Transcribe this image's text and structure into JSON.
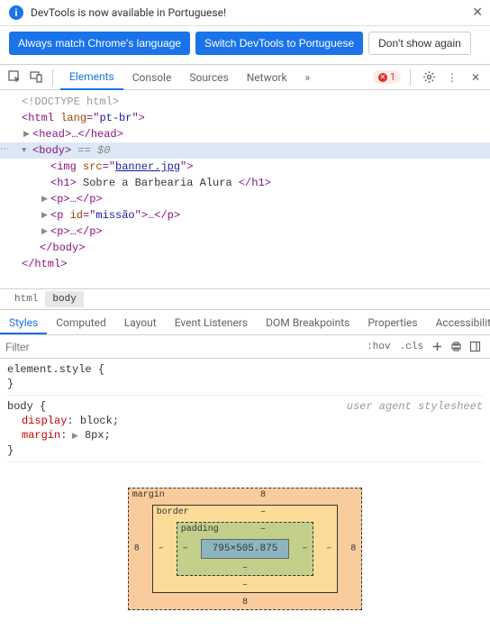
{
  "infobar": {
    "message": "DevTools is now available in Portuguese!",
    "buttons": {
      "match": "Always match Chrome's language",
      "switch": "Switch DevTools to Portuguese",
      "dismiss": "Don't show again"
    }
  },
  "toolbar": {
    "tabs": [
      "Elements",
      "Console",
      "Sources",
      "Network"
    ],
    "active_tab": "Elements",
    "errors": "1"
  },
  "dom": {
    "l0": "<!DOCTYPE html>",
    "l1_open": "<",
    "l1_tag": "html",
    "l1_attr": " lang",
    "l1_eq": "=\"",
    "l1_val": "pt-br",
    "l1_close": "\">",
    "l2_open": "<",
    "l2_tag": "head",
    "l2_close": ">",
    "l2_ell": "…",
    "l2_eopen": "</",
    "l2_eclose": ">",
    "l3_open": "<",
    "l3_tag": "body",
    "l3_close": ">",
    "l3_hint": " == $0",
    "l4_open": "<",
    "l4_tag": "img",
    "l4_attr": " src",
    "l4_eq": "=\"",
    "l4_val": "banner.jpg",
    "l4_close": "\">",
    "l5_open": "<",
    "l5_tag": "h1",
    "l5_close": ">",
    "l5_text": " Sobre a Barbearia Alura ",
    "l5_eopen": "</",
    "l5_eclose": ">",
    "l6_open": "<",
    "l6_tag": "p",
    "l6_close": ">",
    "l6_ell": "…",
    "l6_eopen": "</",
    "l6_eclose": ">",
    "l7_open": "<",
    "l7_tag": "p",
    "l7_attr": " id",
    "l7_eq": "=\"",
    "l7_val": "missão",
    "l7_mid": "\">",
    "l7_ell": "…",
    "l7_eopen": "</",
    "l7_eclose": ">",
    "l8_open": "<",
    "l8_tag": "p",
    "l8_close": ">",
    "l8_ell": "…",
    "l8_eopen": "</",
    "l8_eclose": ">",
    "l9_open": "</",
    "l9_tag": "body",
    "l9_close": ">",
    "l10_open": "</",
    "l10_tag": "html",
    "l10_close": ">"
  },
  "crumbs": [
    "html",
    "body"
  ],
  "styles_tabs": [
    "Styles",
    "Computed",
    "Layout",
    "Event Listeners",
    "DOM Breakpoints",
    "Properties",
    "Accessibility"
  ],
  "filter": {
    "placeholder": "Filter",
    "hov": ":hov",
    "cls": ".cls"
  },
  "css": {
    "block1_sel": "element.style",
    "block2_sel": "body",
    "block2_origin": "user agent stylesheet",
    "p1_name": "display",
    "p1_val": " block",
    "p2_name": "margin",
    "p2_val": " 8px",
    "brace_open": " {",
    "brace_close": "}",
    "colon": ":",
    "semi": ";"
  },
  "boxmodel": {
    "margin_label": "margin",
    "margin_t": "8",
    "margin_r": "8",
    "margin_b": "8",
    "margin_l": "8",
    "border_label": "border",
    "border_v": "–",
    "padding_label": "padding",
    "padding_v": "–",
    "content": "795×505.875"
  }
}
